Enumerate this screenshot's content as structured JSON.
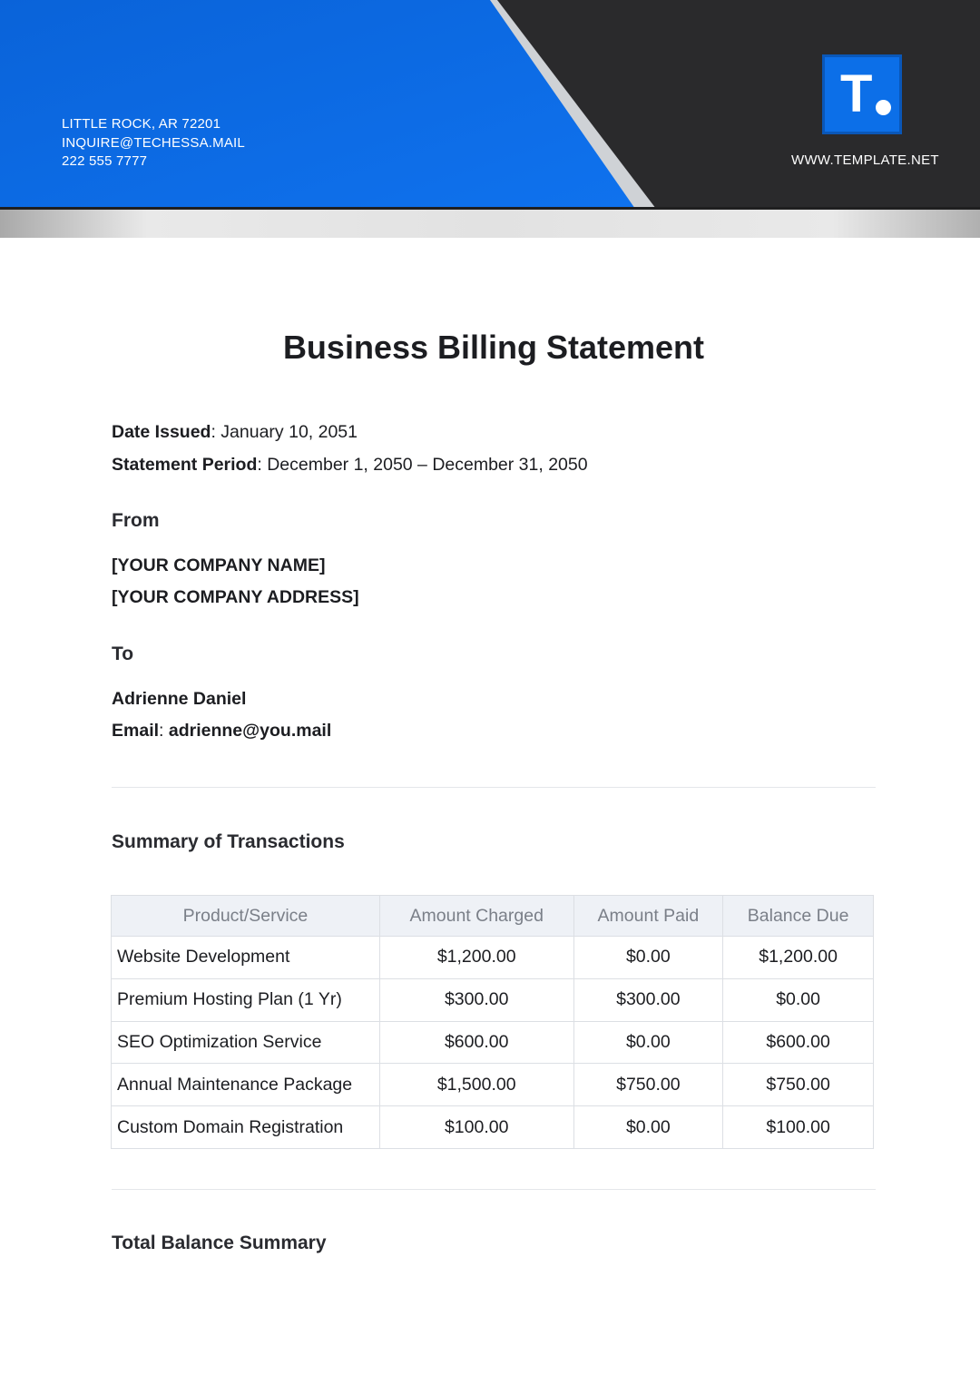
{
  "header": {
    "contact": [
      "LITTLE ROCK, AR 72201",
      "INQUIRE@TECHESSA.MAIL",
      "222 555 7777"
    ],
    "website": "WWW.TEMPLATE.NET",
    "logo_letter": "T",
    "colors": {
      "blue": "#0c6fe8",
      "dark": "#2a2a2c",
      "silver": "#e3e3e3"
    }
  },
  "title": "Business Billing Statement",
  "meta": {
    "date_label": "Date Issued",
    "date_value": ": January 10, 2051",
    "period_label": "Statement Period",
    "period_value": ": December 1, 2050 – December 31, 2050"
  },
  "from": {
    "heading": "From",
    "name": "[YOUR COMPANY NAME]",
    "address": "[YOUR COMPANY ADDRESS]"
  },
  "to": {
    "heading": "To",
    "name": "Adrienne Daniel",
    "email_label": "Email",
    "email_sep": ": ",
    "email_value": "adrienne@you.mail"
  },
  "summary": {
    "heading": "Summary of Transactions",
    "columns": [
      "Product/Service",
      "Amount Charged",
      "Amount Paid",
      "Balance Due"
    ],
    "rows": [
      [
        "Website Development",
        "$1,200.00",
        "$0.00",
        "$1,200.00"
      ],
      [
        "Premium Hosting Plan (1 Yr)",
        "$300.00",
        "$300.00",
        "$0.00"
      ],
      [
        "SEO Optimization Service",
        "$600.00",
        "$0.00",
        "$600.00"
      ],
      [
        "Annual Maintenance Package",
        "$1,500.00",
        "$750.00",
        "$750.00"
      ],
      [
        "Custom Domain Registration",
        "$100.00",
        "$0.00",
        "$100.00"
      ]
    ]
  },
  "total": {
    "heading": "Total Balance Summary"
  }
}
